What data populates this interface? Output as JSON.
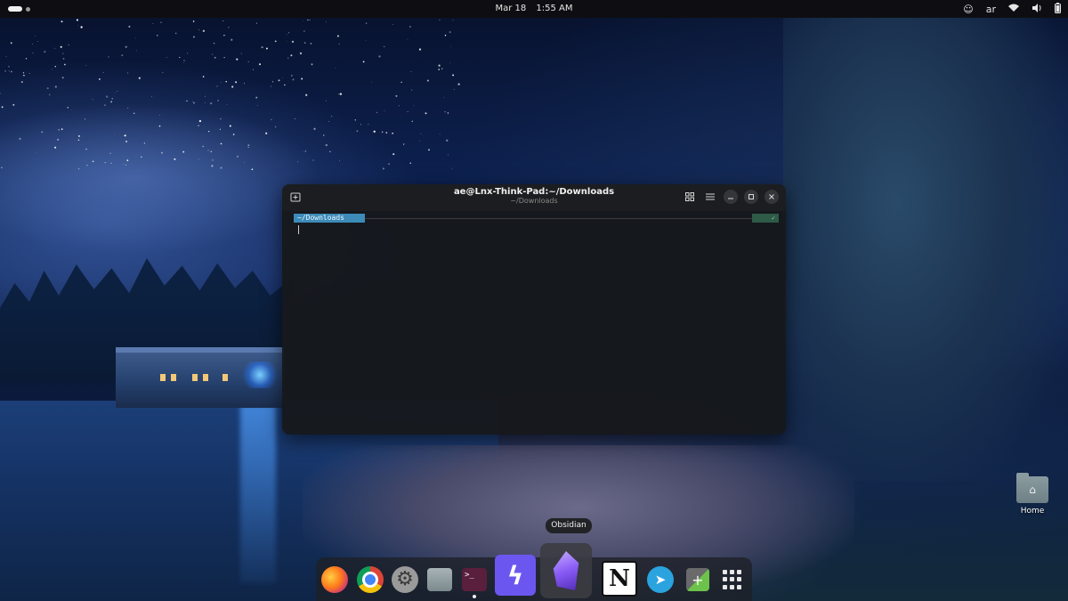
{
  "topbar": {
    "date": "Mar 18",
    "time": "1:55 AM",
    "language": "ar",
    "tray_icons": [
      "indicator-icon",
      "wifi-icon",
      "volume-icon",
      "battery-icon"
    ]
  },
  "terminal": {
    "title": "ae@Lnx-Think-Pad:~/Downloads",
    "subtitle": "~/Downloads",
    "prompt_path": "~/Downloads",
    "prompt_status": "✓",
    "accent": "#3d8bb8"
  },
  "desktop": {
    "home_label": "Home"
  },
  "dock": {
    "tooltip": "Obsidian",
    "apps": [
      "firefox",
      "chrome",
      "settings",
      "files",
      "terminal",
      "bolt",
      "obsidian",
      "notion",
      "telegram",
      "extension-manager",
      "app-grid"
    ],
    "notion_glyph": "N",
    "terminal_glyph": ">_"
  }
}
